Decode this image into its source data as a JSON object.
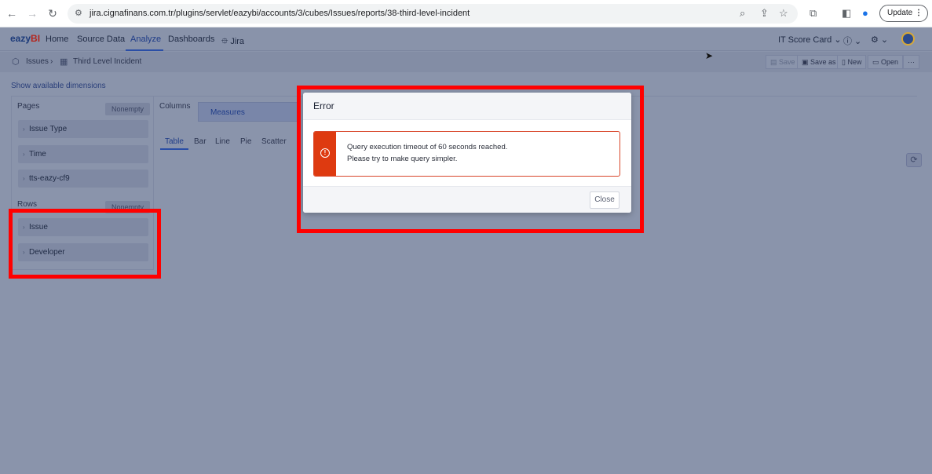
{
  "browser": {
    "url": "jira.cignafinans.com.tr/plugins/servlet/eazybi/accounts/3/cubes/Issues/reports/38-third-level-incident",
    "update_label": "Update"
  },
  "app": {
    "logo": "eazyBI",
    "nav": [
      "Home",
      "Source Data",
      "Analyze",
      "Dashboards",
      "Jira"
    ],
    "account": "IT Score Card"
  },
  "breadcrumb": {
    "cube": "Issues",
    "report": "Third Level Incident"
  },
  "toolbar": {
    "save": "Save",
    "save_as": "Save as",
    "new": "New",
    "open": "Open",
    "more": "···"
  },
  "workspace": {
    "show_dimensions": "Show available dimensions",
    "pages_label": "Pages",
    "pages_nonempty": "Nonempty",
    "pages": [
      "Issue Type",
      "Time",
      "tts-eazy-cf9"
    ],
    "rows_label": "Rows",
    "rows_nonempty": "Nonempty",
    "rows": [
      "Issue",
      "Developer"
    ],
    "columns_label": "Columns",
    "columns_measures": "Measures",
    "viz_tabs": [
      "Table",
      "Bar",
      "Line",
      "Pie",
      "Scatter"
    ]
  },
  "modal": {
    "title": "Error",
    "message_line1": "Query execution timeout of 60 seconds reached.",
    "message_line2": "Please try to make query simpler.",
    "close_label": "Close"
  }
}
